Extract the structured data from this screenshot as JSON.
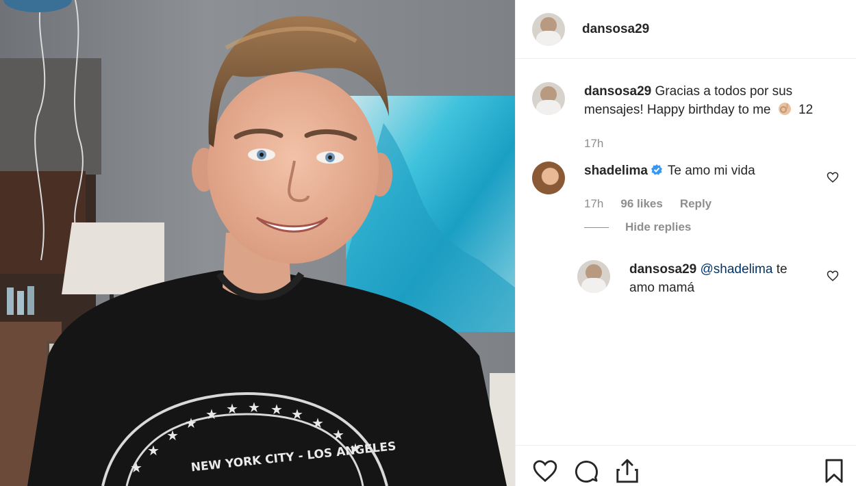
{
  "post": {
    "owner": "dansosa29"
  },
  "caption": {
    "username": "dansosa29",
    "line1": "Gracias a todos por sus",
    "line2_text": "mensajes! Happy birthday to me",
    "line2_tail": "12",
    "emoji": "ok-hand-emoji",
    "time": "17h"
  },
  "comments": [
    {
      "username": "shadelima",
      "verified": true,
      "text": "Te amo mi vida",
      "time": "17h",
      "likes": "96 likes",
      "reply": "Reply",
      "hide_replies": "Hide replies"
    }
  ],
  "replies": [
    {
      "username": "dansosa29",
      "mention": "@shadelima",
      "text_after_mention": "te",
      "text_line2": "amo mamá"
    }
  ],
  "photo": {
    "shirt_text": "NEW YORK CITY - LOS ANGELES"
  },
  "colors": {
    "verified": "#3897f0",
    "mention": "#003569",
    "muted": "#8e8e8e"
  },
  "icons": {
    "like": "heart-icon",
    "comment": "comment-icon",
    "share": "share-icon",
    "save": "bookmark-icon"
  }
}
